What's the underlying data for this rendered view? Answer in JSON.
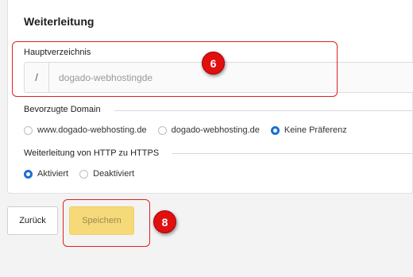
{
  "section": {
    "title": "Weiterleitung"
  },
  "root_dir": {
    "label": "Hauptverzeichnis",
    "prefix": "/",
    "placeholder": "dogado-webhostingde"
  },
  "preferred_domain": {
    "label": "Bevorzugte Domain",
    "options": [
      {
        "label": "www.dogado-webhosting.de",
        "selected": false
      },
      {
        "label": "dogado-webhosting.de",
        "selected": false
      },
      {
        "label": "Keine Präferenz",
        "selected": true
      }
    ]
  },
  "https_redirect": {
    "label": "Weiterleitung von HTTP zu HTTPS",
    "options": [
      {
        "label": "Aktiviert",
        "selected": true
      },
      {
        "label": "Deaktiviert",
        "selected": false
      }
    ]
  },
  "buttons": {
    "back_label": "Zurück",
    "save_label": "Speichern"
  },
  "annotations": {
    "badge_root": "6",
    "badge_save": "8"
  },
  "colors": {
    "accent": "#1a6fd1",
    "save_bg": "#f6d978",
    "annotation_red": "#e01010"
  }
}
